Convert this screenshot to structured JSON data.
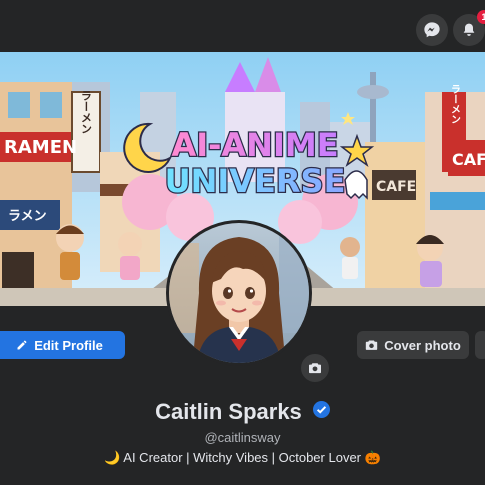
{
  "topbar": {
    "messenger_icon": "messenger-icon",
    "notifications_icon": "bell-icon",
    "notification_count": "1"
  },
  "cover": {
    "banner_line1": "AI-ANIME",
    "banner_line2": "UNIVERSE",
    "sign_ramen_vertical": "ラーメン",
    "sign_ramen": "RAMEN",
    "sign_ramen_small": "ラメン",
    "sign_cafe": "CAFE",
    "sign_cafe_partial": "CAF",
    "sign_ramen_right": "ラーメン"
  },
  "profile": {
    "edit_profile_label": "Edit Profile",
    "cover_photo_label": "Cover photo",
    "name": "Caitlin Sparks",
    "handle": "@caitlinsway",
    "bio": "🌙 AI Creator | Witchy Vibes | October Lover 🎃"
  },
  "colors": {
    "accent": "#2374e1",
    "background": "#18191a",
    "surface": "#242526",
    "notification_badge": "#e41e3f"
  }
}
